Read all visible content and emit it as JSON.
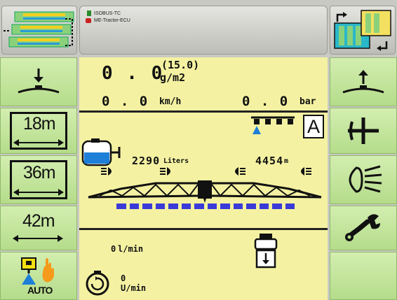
{
  "header": {
    "device_line": "ISOBUS-TC",
    "ecu_line": "ME-Tractor-ECU"
  },
  "readouts": {
    "rate_value": "0 . 0",
    "rate_target": "(15.0)",
    "rate_unit": "g/m2",
    "speed_value": "0 . 0",
    "speed_unit": "km/h",
    "pressure_value": "0 . 0",
    "pressure_unit": "bar",
    "mode_letter": "A",
    "tank_value": "2290",
    "tank_unit": "Liters",
    "distance_value": "4454",
    "distance_unit": "m",
    "flow_value": "0",
    "flow_unit": "l/min",
    "rpm_value": "0",
    "rpm_unit": "U/min"
  },
  "left_keys": {
    "width_18": "18m",
    "width_36": "36m",
    "width_42": "42m",
    "auto_label": "AUTO"
  },
  "colors": {
    "softkey": "#b4dc8a",
    "display": "#f4f2a2",
    "nozzle_blue": "#3a3ad8",
    "accent_blue": "#1e7fd8",
    "auto_yellow": "#f4e010",
    "auto_orange": "#f59a1a",
    "ecu_red": "#c82020"
  },
  "icons": {
    "top_left": "section-layout-icon",
    "top_right": "section-layout-icon",
    "lower_boom": "boom-down-icon",
    "raise_boom": "boom-up-icon",
    "fold": "boom-fold-icon",
    "lights": "work-light-icon",
    "settings": "wrench-icon",
    "auto_mode": "auto-mode-icon"
  }
}
